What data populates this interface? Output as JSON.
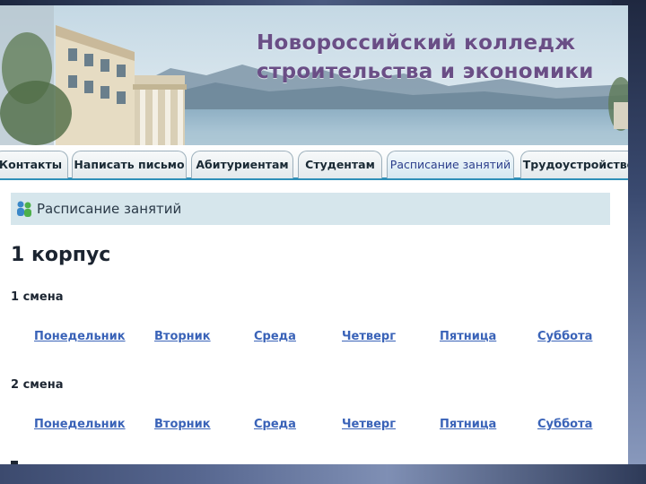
{
  "header": {
    "title_line1": "Новороссийский колледж",
    "title_line2": "строительства и экономики"
  },
  "tabs": [
    {
      "label": "Контакты"
    },
    {
      "label": "Написать письмо"
    },
    {
      "label": "Абитуриентам"
    },
    {
      "label": "Студентам"
    },
    {
      "label": "Расписание занятий",
      "active": true
    },
    {
      "label": "Трудоустройство"
    }
  ],
  "page": {
    "section_title": "Расписание занятий",
    "building": "1 корпус",
    "shifts": [
      {
        "label": "1 смена",
        "days": [
          "Понедельник",
          "Вторник",
          "Среда",
          "Четверг",
          "Пятница",
          "Суббота"
        ]
      },
      {
        "label": "2 смена",
        "days": [
          "Понедельник",
          "Вторник",
          "Среда",
          "Четверг",
          "Пятница",
          "Суббота"
        ]
      }
    ]
  },
  "colors": {
    "title": "#6a4e86",
    "link": "#3a63b8",
    "tab_underline": "#2f8fb8",
    "page_bar": "#d6e6ec"
  }
}
